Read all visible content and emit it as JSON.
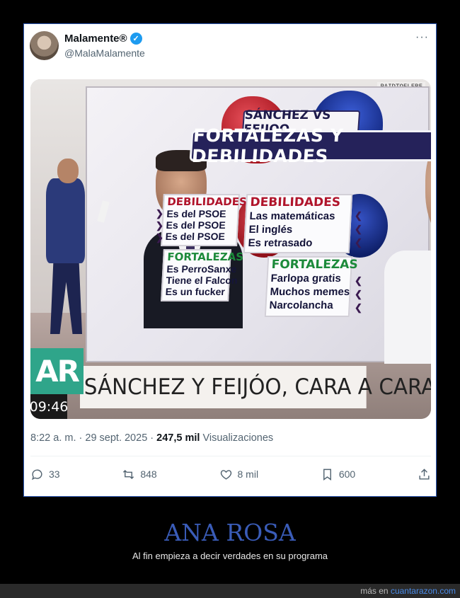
{
  "tweet": {
    "display_name": "Malamente®",
    "handle": "@MalaMalamente",
    "more_glyph": "···",
    "time": "8:22 a. m.",
    "separator": " · ",
    "date": "29 sept. 2025",
    "views_count": "247,5 mil",
    "views_label": "Visualizaciones",
    "actions": {
      "replies": "33",
      "reposts": "848",
      "likes": "8 mil",
      "bookmarks": "600"
    }
  },
  "tv_graphic": {
    "subtitle": "SÁNCHEZ VS FEIJOO",
    "title": "FORTALEZAS Y DEBILIDADES",
    "watermark": "PAIDTOELEBE",
    "left": {
      "debilidades_heading": "DEBILIDADES",
      "debilidades": [
        "Es del PSOE",
        "Es del PSOE",
        "Es del PSOE"
      ],
      "fortalezas_heading": "FORTALEZAS",
      "fortalezas": [
        "Es PerroSanxe",
        "Tiene el Falcon",
        "Es un fucker"
      ]
    },
    "right": {
      "debilidades_heading": "DEBILIDADES",
      "debilidades": [
        "Las matemáticas",
        "El inglés",
        "Es retrasado"
      ],
      "fortalezas_heading": "FORTALEZAS",
      "fortalezas": [
        "Farlopa gratis",
        "Muchos memes",
        "Narcolancha"
      ]
    },
    "logo": "AR",
    "ticker": "SÁNCHEZ Y FEIJÓO, CARA A CARA",
    "clock": "09:46"
  },
  "footer": {
    "title": "ANA ROSA",
    "subtitle": "Al fin empieza a decir verdades en su programa",
    "more_prefix": "más en ",
    "site": "cuantarazon.com"
  },
  "colors": {
    "verified": "#1d9bf0",
    "footer_title": "#3a5cb8",
    "debilidades": "#b0142b",
    "fortalezas": "#1c8a3a",
    "graphic_navy": "#25225a"
  }
}
